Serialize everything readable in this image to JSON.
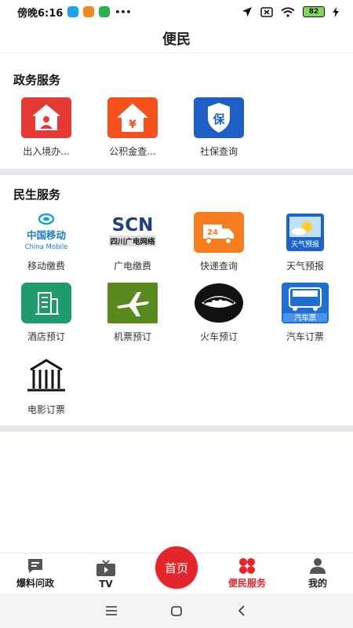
{
  "status_bar": {
    "time": "傍晚6:16",
    "more": "•••",
    "battery": "82"
  },
  "header": {
    "title": "便民"
  },
  "gov_services": {
    "title": "政务服务",
    "items": [
      {
        "label": "出入境办...",
        "icon": "house-person-icon",
        "color": "#e53935"
      },
      {
        "label": "公积金查...",
        "icon": "house-yuan-icon",
        "color": "#f4511e"
      },
      {
        "label": "社保查询",
        "icon": "shield-bao-icon",
        "color": "#1e5fc6",
        "glyph": "保"
      }
    ]
  },
  "life_services": {
    "title": "民生服务",
    "items": [
      {
        "label": "移动缴费",
        "icon": "china-mobile-logo",
        "logo_cn": "中国移动",
        "logo_en": "China Mobile"
      },
      {
        "label": "广电缴费",
        "icon": "scn-logo",
        "logo_text": "SCN",
        "logo_cn": "四川广电网络"
      },
      {
        "label": "快递查询",
        "icon": "delivery-truck-icon",
        "glyph": "24",
        "color": "#f57c1f"
      },
      {
        "label": "天气预报",
        "icon": "weather-icon",
        "logo_cn": "天气预报",
        "color": "#1e63c6"
      },
      {
        "label": "酒店预订",
        "icon": "hotel-icon",
        "color": "#1f9b6b"
      },
      {
        "label": "机票预订",
        "icon": "airplane-icon",
        "color": "#5a8a1e"
      },
      {
        "label": "火车预订",
        "icon": "train-icon",
        "color": "#111111"
      },
      {
        "label": "汽车订票",
        "icon": "bus-icon",
        "logo_cn": "汽车票",
        "color": "#1e6fd0"
      },
      {
        "label": "电影订票",
        "icon": "cinema-icon"
      }
    ]
  },
  "tabbar": {
    "tabs": [
      {
        "label": "爆料问政",
        "icon": "report-icon"
      },
      {
        "label": "TV",
        "icon": "tv-icon"
      },
      {
        "label": "便民服务",
        "icon": "service-icon",
        "active": true
      },
      {
        "label": "我的",
        "icon": "profile-icon"
      }
    ],
    "home_label": "首页",
    "accent": "#e3262b"
  },
  "system_nav": [
    "menu-icon",
    "home-square-icon",
    "back-icon"
  ]
}
